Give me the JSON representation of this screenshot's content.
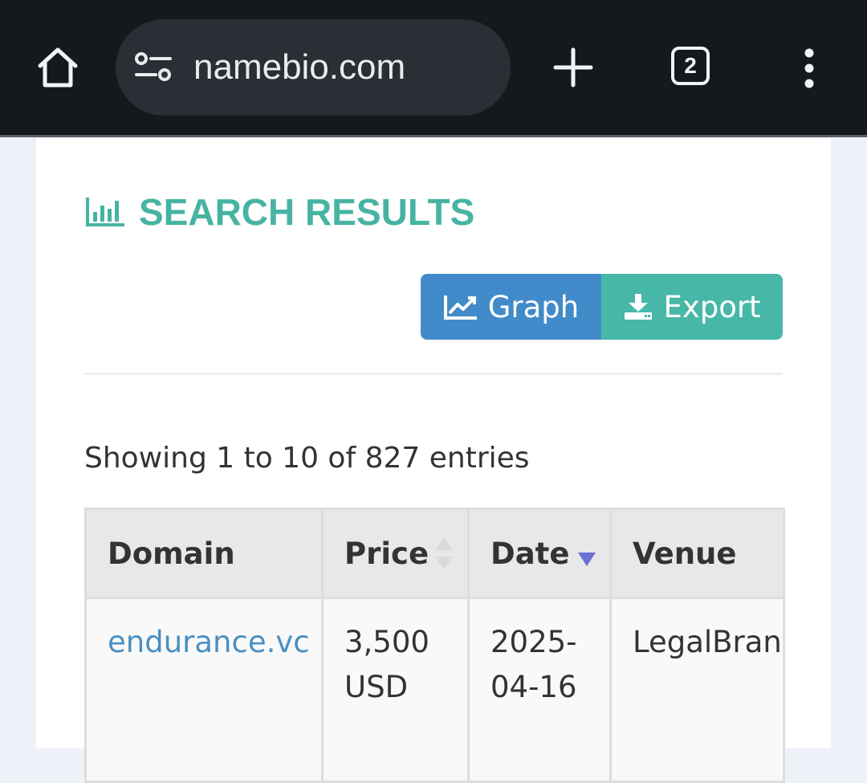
{
  "browser": {
    "url": "namebio.com",
    "tab_count": "2",
    "icons": [
      "home-icon",
      "site-info-icon",
      "plus-icon",
      "tabs-icon",
      "menu-icon"
    ]
  },
  "page": {
    "heading": "SEARCH RESULTS",
    "buttons": {
      "graph_label": "Graph",
      "export_label": "Export"
    },
    "info": "Showing 1 to 10 of 827 entries",
    "colors": {
      "heading": "#47b3a3",
      "graph": "#428bca",
      "export": "#47b8a8",
      "link": "#4a90c2",
      "sort_active": "#6b6fd6"
    }
  },
  "table": {
    "columns": [
      "Domain",
      "Price",
      "Date",
      "Venue"
    ],
    "rows": [
      {
        "domain": "endurance.vc",
        "price_amount": "3,500",
        "price_currency": "USD",
        "date_year": "2025-",
        "date_rest": "04-16",
        "venue": "LegalBrand"
      }
    ]
  }
}
